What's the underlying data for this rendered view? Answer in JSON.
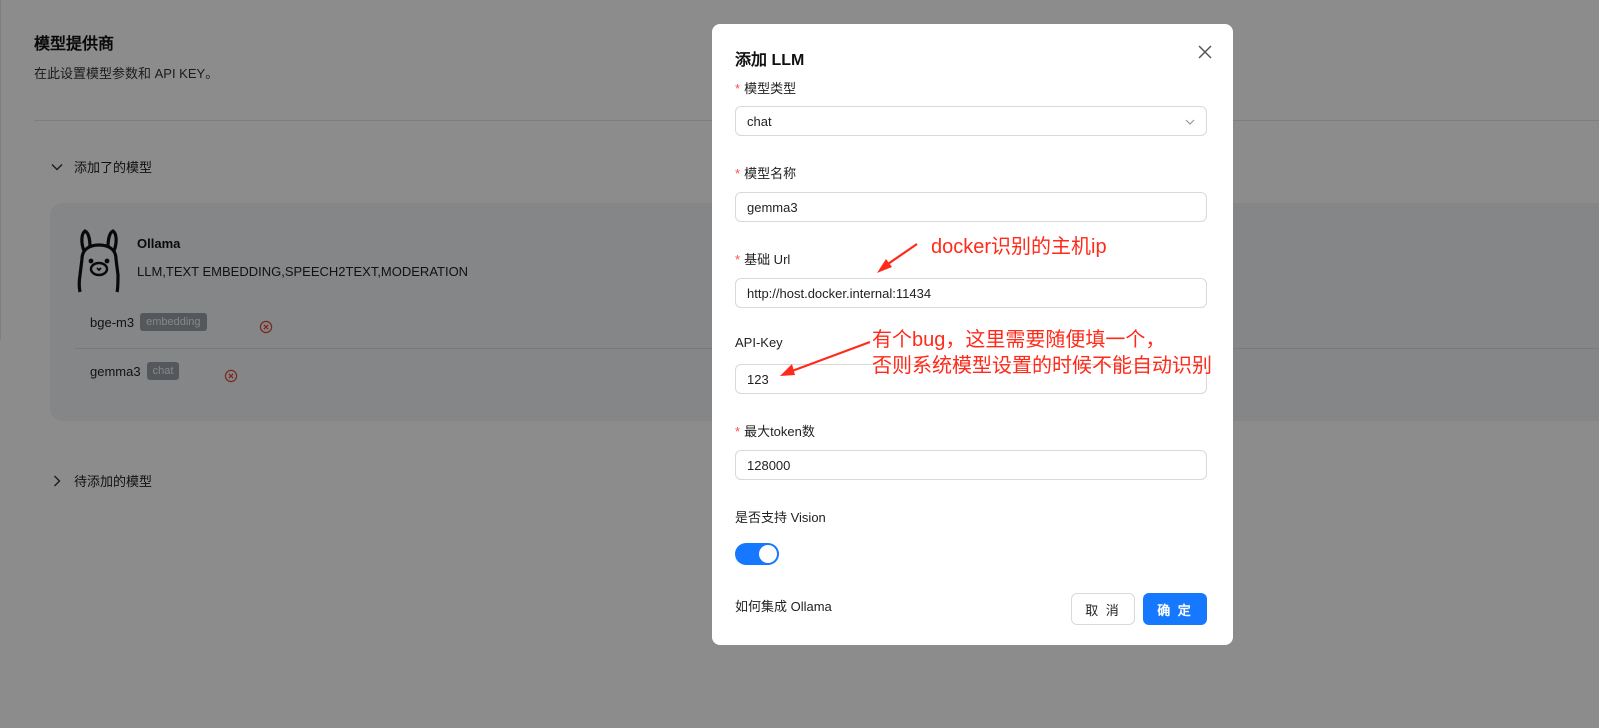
{
  "page": {
    "title": "模型提供商",
    "subtitle": "在此设置模型参数和 API KEY。"
  },
  "sections": {
    "added": "添加了的模型",
    "pending": "待添加的模型"
  },
  "provider": {
    "name": "Ollama",
    "capabilities": "LLM,TEXT EMBEDDING,SPEECH2TEXT,MODERATION",
    "models": [
      {
        "name": "bge-m3",
        "tag": "embedding"
      },
      {
        "name": "gemma3",
        "tag": "chat"
      }
    ]
  },
  "modal": {
    "title": "添加 LLM",
    "fields": {
      "model_type": {
        "label": "模型类型",
        "value": "chat",
        "required": true
      },
      "model_name": {
        "label": "模型名称",
        "value": "gemma3",
        "required": true
      },
      "base_url": {
        "label": "基础 Url",
        "value": "http://host.docker.internal:11434",
        "required": true
      },
      "api_key": {
        "label": "API-Key",
        "value": "123",
        "required": false
      },
      "max_tokens": {
        "label": "最大token数",
        "value": "128000",
        "required": true
      },
      "vision": {
        "label": "是否支持 Vision",
        "enabled": true
      }
    },
    "help_link": "如何集成 Ollama",
    "cancel_label": "取 消",
    "ok_label": "确 定"
  },
  "annotations": {
    "url_note": "docker识别的主机ip",
    "key_note_line1": "有个bug，这里需要随便填一个，",
    "key_note_line2": "否则系统模型设置的时候不能自动识别"
  },
  "colors": {
    "primary": "#1677ff",
    "required": "#ff4d4f",
    "annotation": "#ff2a1a",
    "tag_bg": "#9aa1a9",
    "delete_icon": "#e0453a"
  }
}
